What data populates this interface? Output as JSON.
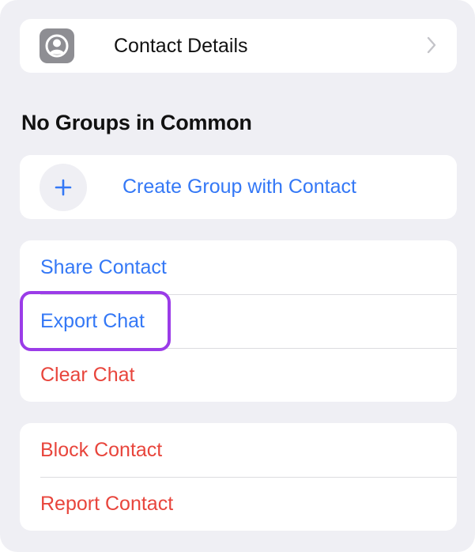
{
  "contact_details": {
    "label": "Contact Details",
    "icon": "person-circle-icon"
  },
  "groups": {
    "section_title": "No Groups in Common",
    "create_label": "Create Group with Contact",
    "icon": "plus-icon"
  },
  "actions": {
    "share_contact": "Share Contact",
    "export_chat": "Export Chat",
    "clear_chat": "Clear Chat"
  },
  "safety": {
    "block_contact": "Block Contact",
    "report_contact": "Report Contact"
  },
  "colors": {
    "background": "#efeff4",
    "card": "#ffffff",
    "link_blue": "#3478f6",
    "destructive_red": "#e8453c",
    "highlight_purple": "#9b3ce8"
  }
}
